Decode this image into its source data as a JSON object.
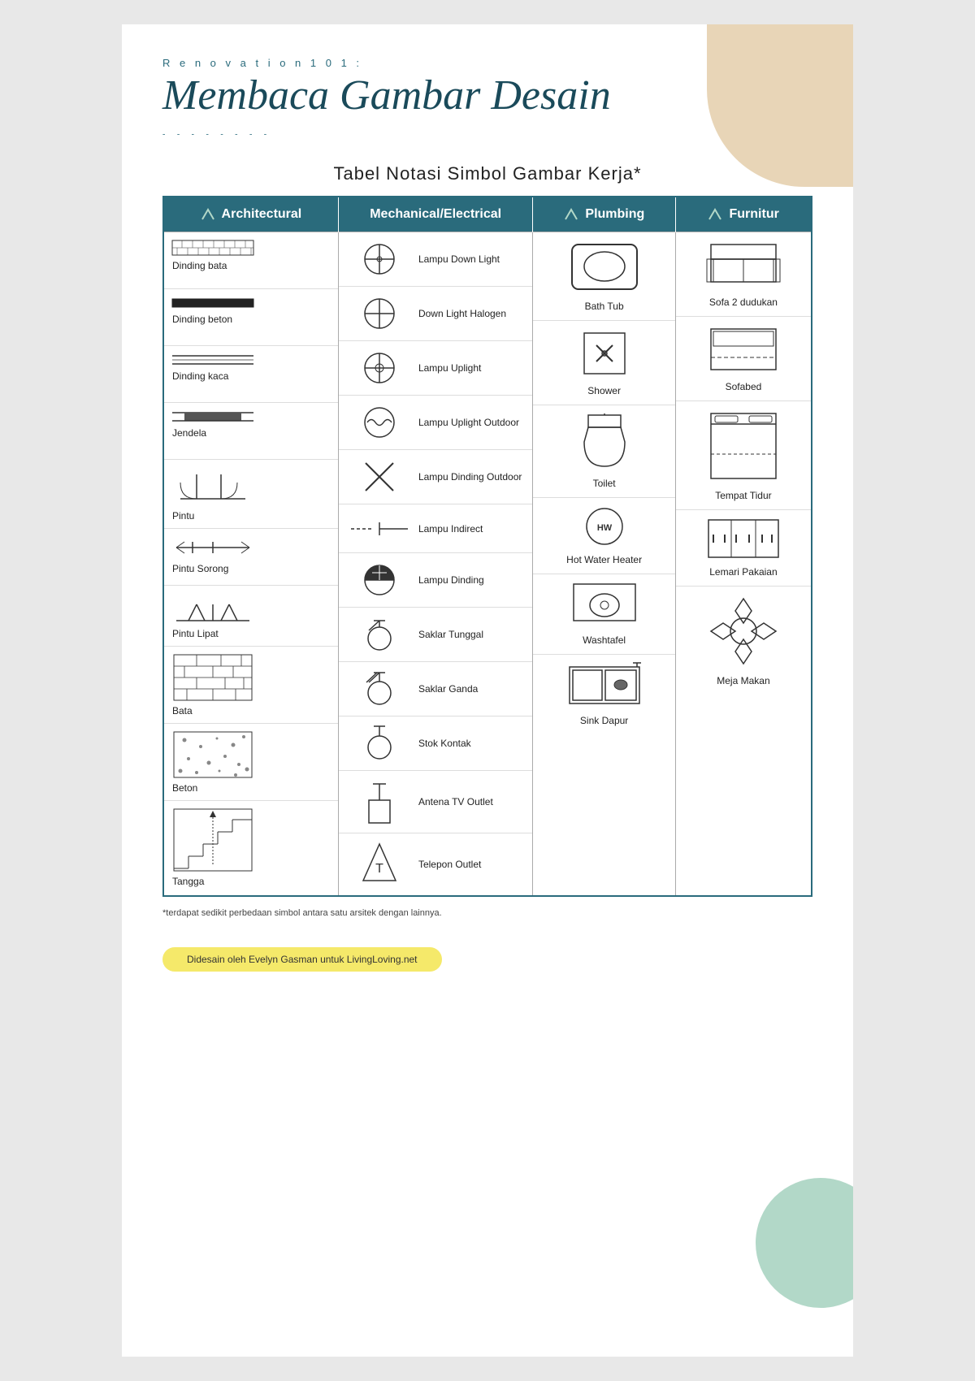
{
  "header": {
    "subtitle": "R e n o v a t i o n   1 0 1 :",
    "title": "Membaca Gambar Desain",
    "dots": "- - - - - - - -"
  },
  "table_title": "Tabel Notasi Simbol Gambar Kerja*",
  "columns": [
    {
      "key": "architectural",
      "label": "Architectural"
    },
    {
      "key": "mechanical",
      "label": "Mechanical/Electrical"
    },
    {
      "key": "plumbing",
      "label": "Plumbing"
    },
    {
      "key": "furniture",
      "label": "Furnitur"
    }
  ],
  "architectural_items": [
    {
      "label": "Dinding bata"
    },
    {
      "label": "Dinding beton"
    },
    {
      "label": "Dinding kaca"
    },
    {
      "label": "Jendela"
    },
    {
      "label": "Pintu"
    },
    {
      "label": "Pintu Sorong"
    },
    {
      "label": "Pintu Lipat"
    },
    {
      "label": "Bata"
    },
    {
      "label": "Beton"
    },
    {
      "label": "Tangga"
    }
  ],
  "mechanical_items": [
    {
      "label": "Lampu Down Light"
    },
    {
      "label": "Down Light Halogen"
    },
    {
      "label": "Lampu Uplight"
    },
    {
      "label": "Lampu Uplight Outdoor"
    },
    {
      "label": "Lampu Dinding Outdoor"
    },
    {
      "label": "Lampu Indirect"
    },
    {
      "label": "Lampu Dinding"
    },
    {
      "label": "Saklar Tunggal"
    },
    {
      "label": "Saklar Ganda"
    },
    {
      "label": "Stok Kontak"
    },
    {
      "label": "Antena TV Outlet"
    },
    {
      "label": "Telepon Outlet"
    }
  ],
  "plumbing_items": [
    {
      "label": "Bath Tub"
    },
    {
      "label": "Shower"
    },
    {
      "label": "Toilet"
    },
    {
      "label": "Hot Water Heater"
    },
    {
      "label": "Washtafel"
    },
    {
      "label": "Sink Dapur"
    }
  ],
  "furniture_items": [
    {
      "label": "Sofa 2 dudukan"
    },
    {
      "label": "Sofabed"
    },
    {
      "label": "Tempat Tidur"
    },
    {
      "label": "Lemari Pakaian"
    },
    {
      "label": "Meja Makan"
    }
  ],
  "footer_note": "*terdapat sedikit perbedaan simbol antara satu arsitek dengan lainnya.",
  "footer_credit": "Didesain oleh Evelyn Gasman untuk LivingLoving.net"
}
